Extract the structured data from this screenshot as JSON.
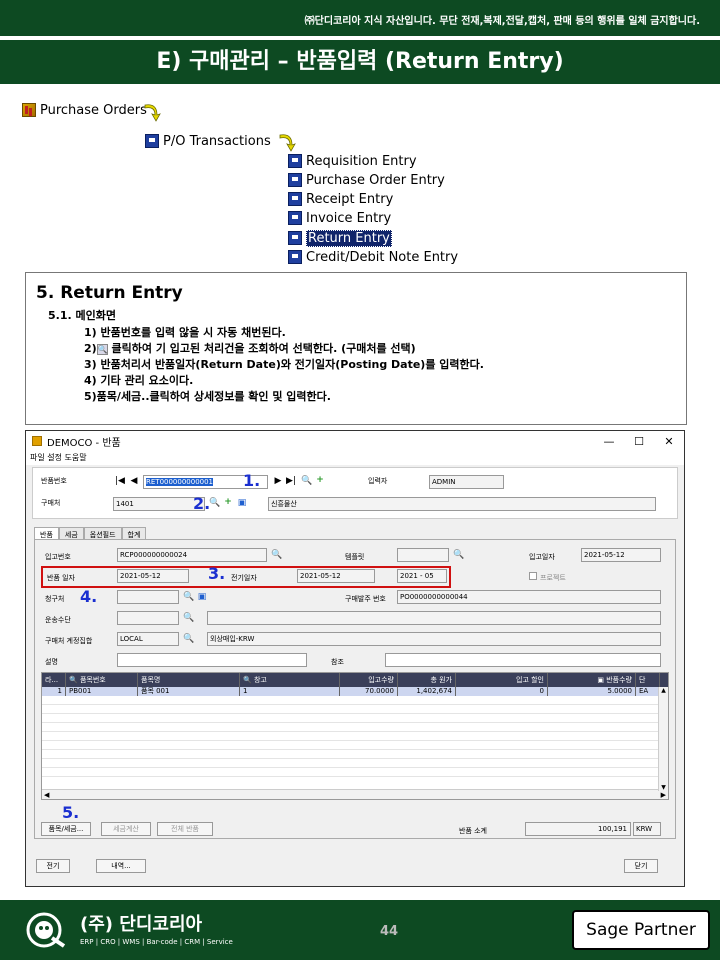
{
  "banner": "㈜단디코리아 지식 자산입니다. 무단 전재,복제,전달,캡처, 판매 등의 행위를 일체 금지합니다.",
  "title": "E) 구매관리 – 반품입력 (Return Entry)",
  "menu": {
    "root": "Purchase Orders",
    "group": "P/O Transactions",
    "items": [
      "Requisition Entry",
      "Purchase Order Entry",
      "Receipt Entry",
      "Invoice Entry",
      "Return Entry",
      "Credit/Debit Note Entry"
    ],
    "selected_index": 4
  },
  "section": {
    "heading": "5. Return Entry",
    "sub": "5.1. 메인화면",
    "steps": [
      "1) 반품번호를 입력 않을 시 자동 채번된다.",
      "2)",
      "클릭하여 기 입고된 처리건을 조회하여 선택한다. (구매처를 선택)",
      "3) 반품처리서 반품일자(Return Date)와 전기일자(Posting Date)를 입력한다.",
      "4) 기타 관리 요소이다.",
      "5)품목/세금..클릭하여 상세정보를 확인 및 입력한다."
    ]
  },
  "window": {
    "title": "DEMOCO - 반품",
    "menubar": "파일 설정 도움말",
    "controls": [
      "—",
      "☐",
      "✕"
    ],
    "header": {
      "return_no_label": "반품번호",
      "return_no_value": "RET000000000001",
      "entered_by_label": "입력자",
      "entered_by_value": "ADMIN",
      "vendor_label": "구매처",
      "vendor_code": "1401",
      "vendor_name": "신흥물산"
    },
    "tabs": [
      "반품",
      "세금",
      "옵션필드",
      "합계"
    ],
    "form": {
      "receipt_no_label": "입고번호",
      "receipt_no_value": "RCP000000000024",
      "template_label": "템플릿",
      "receipt_date_label": "입고일자",
      "receipt_date_value": "2021-05-12",
      "return_date_label": "반품 일자",
      "return_date_value": "2021-05-12",
      "posting_date_label": "전기일자",
      "posting_date_value": "2021-05-12",
      "period_value": "2021 - 05",
      "project_label": "프로젝트",
      "bill_to_label": "청구처",
      "po_no_label": "구매발주 번호",
      "po_no_value": "PO0000000000044",
      "ship_via_label": "운송수단",
      "account_set_label": "구매처 계정집합",
      "account_set_code": "LOCAL",
      "account_set_name": "외상매입-KRW",
      "desc_label": "설명",
      "ref_label": "참조"
    },
    "grid": {
      "columns": [
        "라...",
        "품목번호",
        "품목명",
        "창고",
        "입고수량",
        "총 원가",
        "입고 할인",
        "반품수량",
        "단"
      ],
      "rows": [
        [
          "1",
          "PB001",
          "품목 001",
          "1",
          "70.0000",
          "1,402,674",
          "0",
          "5.0000",
          "EA"
        ]
      ]
    },
    "buttons": {
      "items_tax": "품목/세금...",
      "calc_tax": "세금계산",
      "return_all": "전체 반품",
      "post": "전기",
      "history": "내역...",
      "close": "닫기"
    },
    "total_label": "반품 소계",
    "total_value": "100,191",
    "currency": "KRW"
  },
  "annotations": [
    "1.",
    "2.",
    "3.",
    "4.",
    "5."
  ],
  "footer": {
    "company": "(주) 단디코리아",
    "tagline": "ERP | CRO | WMS | Bar-code | CRM | Service",
    "page": "44",
    "partner": "Sage Partner"
  },
  "colors": {
    "brand_green": "#0d4a22",
    "annotation_blue": "#1a2fd0",
    "highlight_red": "#d01010",
    "grid_header": "#3a3f5a"
  }
}
